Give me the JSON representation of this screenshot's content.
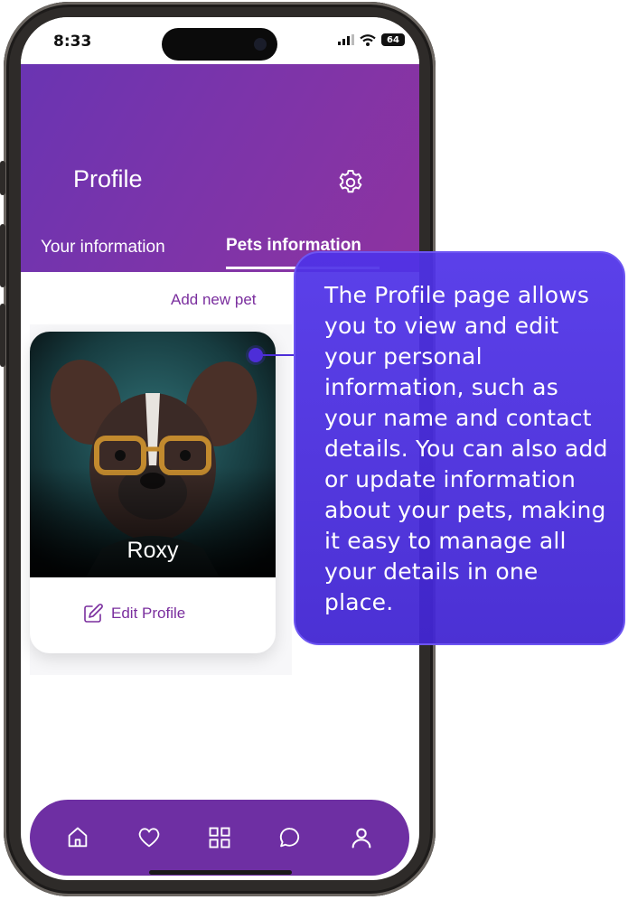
{
  "status_bar": {
    "time": "8:33",
    "battery": "64"
  },
  "header": {
    "title": "Profile",
    "tabs": [
      {
        "label": "Your information",
        "active": false
      },
      {
        "label": "Pets information",
        "active": true
      }
    ]
  },
  "content": {
    "add_pet_label": "Add new pet",
    "pet": {
      "name": "Roxy",
      "edit_label": "Edit Profile"
    }
  },
  "bottom_nav": {
    "items": [
      {
        "icon": "home-icon"
      },
      {
        "icon": "heart-icon"
      },
      {
        "icon": "grid-icon"
      },
      {
        "icon": "chat-icon"
      },
      {
        "icon": "user-icon",
        "active": true
      }
    ]
  },
  "callout": {
    "text": "The Profile page allows you to view and edit your personal information, such as your name and contact details. You can also add or update information about your pets, making it easy to manage all your details in one place."
  },
  "colors": {
    "header_gradient_start": "#6a34b2",
    "header_gradient_end": "#8e33a0",
    "accent_text": "#7a2e9e",
    "nav_background": "#6e2fa3",
    "callout_background": "#4f32e8"
  }
}
